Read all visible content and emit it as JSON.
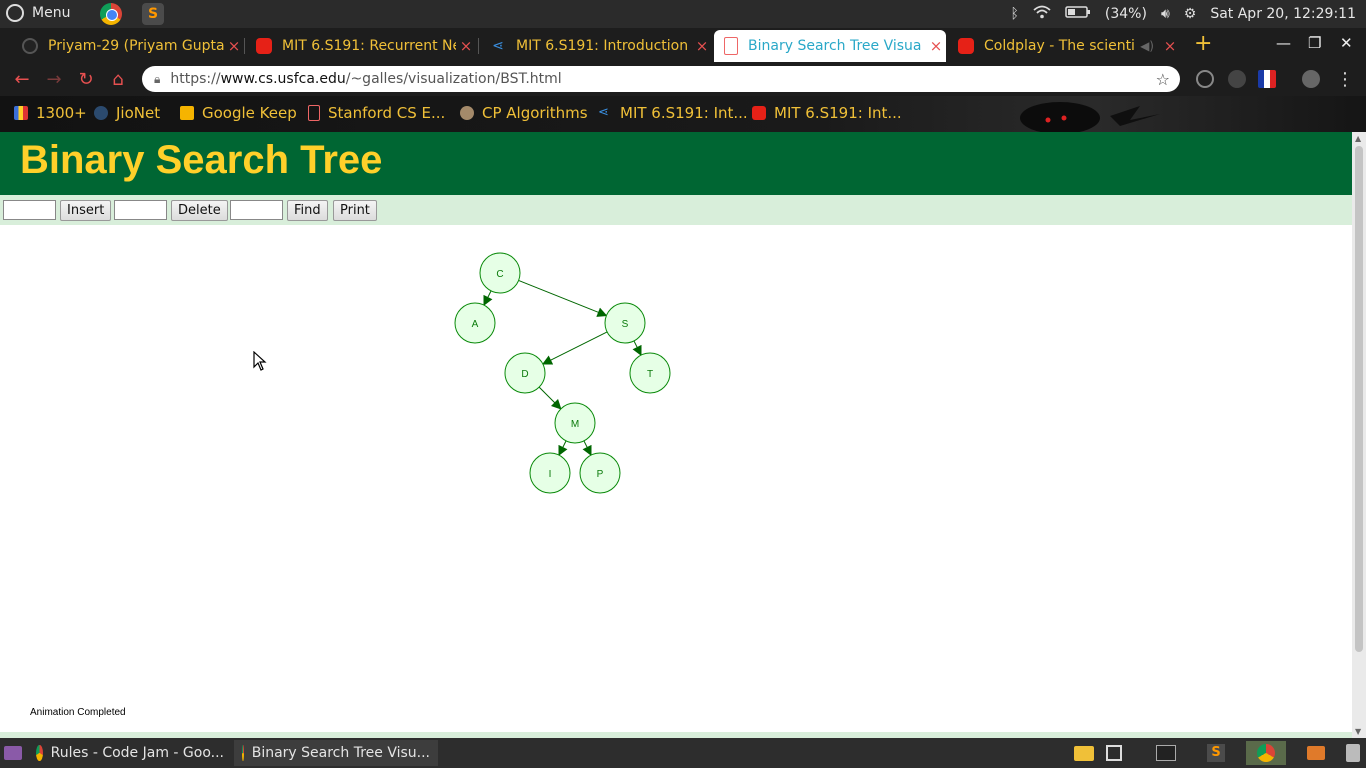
{
  "os_panel": {
    "menu_label": "Menu",
    "battery": "(34%)",
    "datetime": "Sat Apr 20, 12:29:11"
  },
  "tabs": [
    {
      "title": "Priyam-29 (Priyam Gupta)",
      "icon": "github-icon"
    },
    {
      "title": "MIT 6.S191: Recurrent Ne",
      "icon": "youtube-icon"
    },
    {
      "title": "MIT 6.S191: Introduction",
      "icon": "share-icon"
    },
    {
      "title": "Binary Search Tree Visua",
      "icon": "document-icon",
      "active": true
    },
    {
      "title": "Coldplay - The scienti",
      "icon": "youtube-icon"
    }
  ],
  "tab_close_glyph": "×",
  "new_tab_glyph": "+",
  "address_bar": {
    "url_scheme": "https://",
    "url_host": "www.cs.usfca.edu",
    "url_path": "/~galles/visualization/BST.html"
  },
  "bookmarks": [
    {
      "label": "1300+",
      "icon": "bar-chart-icon"
    },
    {
      "label": "JioNet",
      "icon": "jionet-icon"
    },
    {
      "label": "Google Keep",
      "icon": "keep-icon"
    },
    {
      "label": "Stanford CS E...",
      "icon": "document-icon"
    },
    {
      "label": "CP Algorithms",
      "icon": "cp-icon"
    },
    {
      "label": "MIT 6.S191: Int...",
      "icon": "share-icon"
    },
    {
      "label": "MIT 6.S191: Int...",
      "icon": "youtube-icon"
    }
  ],
  "page": {
    "title": "Binary Search Tree",
    "insert_button": "Insert",
    "delete_button": "Delete",
    "find_button": "Find",
    "print_button": "Print",
    "insert_value": "",
    "delete_value": "",
    "find_value": "",
    "status": "Animation Completed"
  },
  "tree": {
    "nodes": [
      {
        "id": "C",
        "label": "C"
      },
      {
        "id": "A",
        "label": "A"
      },
      {
        "id": "S",
        "label": "S"
      },
      {
        "id": "D",
        "label": "D"
      },
      {
        "id": "T",
        "label": "T"
      },
      {
        "id": "M",
        "label": "M"
      },
      {
        "id": "I",
        "label": "I"
      },
      {
        "id": "P",
        "label": "P"
      }
    ],
    "edges": [
      {
        "from": "C",
        "to": "A"
      },
      {
        "from": "C",
        "to": "S"
      },
      {
        "from": "S",
        "to": "D"
      },
      {
        "from": "S",
        "to": "T"
      },
      {
        "from": "D",
        "to": "M"
      },
      {
        "from": "M",
        "to": "I"
      },
      {
        "from": "M",
        "to": "P"
      }
    ],
    "node_fill": "#e6ffe6",
    "node_stroke": "#0a8a0a",
    "edge_color": "#006600"
  },
  "taskbar": [
    {
      "label": "Rules - Code Jam - Goo...",
      "icon": "chrome-icon"
    },
    {
      "label": "Binary Search Tree Visu...",
      "icon": "chrome-icon"
    }
  ],
  "colors": {
    "header_bg": "#006633",
    "header_text": "#ffd02a",
    "controls_bg": "#d8eeda",
    "tab_text": "#f0c038",
    "active_tab_text": "#2aa8c8"
  }
}
